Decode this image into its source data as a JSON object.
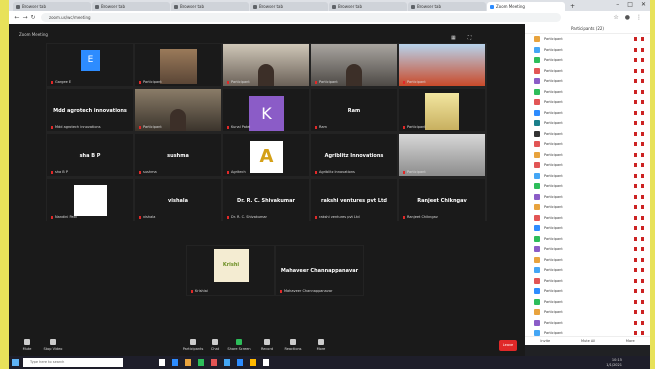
{
  "browser": {
    "tabs": [
      {
        "label": "Browser tab",
        "active": false
      },
      {
        "label": "Browser tab",
        "active": false
      },
      {
        "label": "Browser tab",
        "active": false
      },
      {
        "label": "Browser tab",
        "active": false
      },
      {
        "label": "Browser tab",
        "active": false
      },
      {
        "label": "Browser tab",
        "active": false
      },
      {
        "label": "Zoom Meeting",
        "active": true
      }
    ],
    "url": "zoom.us/wc/meeting"
  },
  "zoom": {
    "meeting_label": "Zoom Meeting",
    "gallery": [
      {
        "name": "Gargee E",
        "kind": "avatar-e",
        "avatar_letter": "E"
      },
      {
        "name": "Participant",
        "kind": "video-a"
      },
      {
        "name": "Participant",
        "kind": "video-room"
      },
      {
        "name": "Participant",
        "kind": "video-room2"
      },
      {
        "name": "Participant",
        "kind": "video-bridge"
      },
      {
        "name": "Mdd agrotech innovations",
        "kind": "text",
        "big": "Mdd agrotech innovations"
      },
      {
        "name": "Participant",
        "kind": "video-room3"
      },
      {
        "name": "Kunal Patel",
        "kind": "avatar-k",
        "avatar_letter": "K"
      },
      {
        "name": "Ram",
        "kind": "text",
        "big": "Ram"
      },
      {
        "name": "Participant",
        "kind": "video-b"
      },
      {
        "name": "sha B P",
        "kind": "text",
        "big": "sha B P"
      },
      {
        "name": "sushma",
        "kind": "text",
        "big": "sushma"
      },
      {
        "name": "Agritech",
        "kind": "avatar-a",
        "avatar_letter": "A"
      },
      {
        "name": "Agriblitz Innovations",
        "kind": "text",
        "big": "Agriblitz Innovations"
      },
      {
        "name": "Participant",
        "kind": "video-gray"
      },
      {
        "name": "Nandini Patil",
        "kind": "avatar-tree"
      },
      {
        "name": "vishala",
        "kind": "text",
        "big": "vishala"
      },
      {
        "name": "Dr. R. C. Shivakumar",
        "kind": "text",
        "big": "Dr. R. C. Shivakumar"
      },
      {
        "name": "rakshi ventures pvt Ltd",
        "kind": "text",
        "big": "rakshi ventures pvt Ltd"
      },
      {
        "name": "Ranjeet Chikngav",
        "kind": "text",
        "big": "Ranjeet Chikngav"
      }
    ],
    "gallery2": [
      {
        "name": "Krishiai",
        "kind": "logo",
        "logo_text": "Krishi"
      },
      {
        "name": "Mahaveer Channappanavar",
        "kind": "text",
        "big": "Mahaveer Channappanavar"
      }
    ],
    "toolbar": {
      "items": [
        "Mute",
        "Stop Video",
        "Participants",
        "Chat",
        "Share Screen",
        "Record",
        "Reactions",
        "More"
      ],
      "leave_label": "Leave"
    }
  },
  "panel": {
    "title": "Participants (22)",
    "participants": [
      {
        "name": "Participant",
        "color": "#e8a33d"
      },
      {
        "name": "Participant",
        "color": "#44a6f5"
      },
      {
        "name": "Participant",
        "color": "#2dbd5a"
      },
      {
        "name": "Participant",
        "color": "#e25555"
      },
      {
        "name": "Participant",
        "color": "#8b5cc7"
      },
      {
        "name": "Participant",
        "color": "#2dbd5a"
      },
      {
        "name": "Participant",
        "color": "#e25555"
      },
      {
        "name": "Participant",
        "color": "#2d8cff"
      },
      {
        "name": "Participant",
        "color": "#1a7f8a"
      },
      {
        "name": "Participant",
        "color": "#333333"
      },
      {
        "name": "Participant",
        "color": "#e25555"
      },
      {
        "name": "Participant",
        "color": "#e8a33d"
      },
      {
        "name": "Participant",
        "color": "#e25555"
      },
      {
        "name": "Participant",
        "color": "#44a6f5"
      },
      {
        "name": "Participant",
        "color": "#2dbd5a"
      },
      {
        "name": "Participant",
        "color": "#8b5cc7"
      },
      {
        "name": "Participant",
        "color": "#e8a33d"
      },
      {
        "name": "Participant",
        "color": "#e25555"
      },
      {
        "name": "Participant",
        "color": "#2d8cff"
      },
      {
        "name": "Participant",
        "color": "#2dbd5a"
      },
      {
        "name": "Participant",
        "color": "#8b5cc7"
      },
      {
        "name": "Participant",
        "color": "#e8a33d"
      },
      {
        "name": "Participant",
        "color": "#44a6f5"
      },
      {
        "name": "Participant",
        "color": "#e25555"
      },
      {
        "name": "Participant",
        "color": "#2d8cff"
      },
      {
        "name": "Participant",
        "color": "#2dbd5a"
      },
      {
        "name": "Participant",
        "color": "#e8a33d"
      },
      {
        "name": "Participant",
        "color": "#8b5cc7"
      },
      {
        "name": "Participant",
        "color": "#44a6f5"
      }
    ],
    "footer": [
      "Invite",
      "Mute All",
      "More"
    ]
  },
  "taskbar": {
    "search_placeholder": "Type here to search",
    "time": "10:15",
    "date": "1/1/2021"
  }
}
